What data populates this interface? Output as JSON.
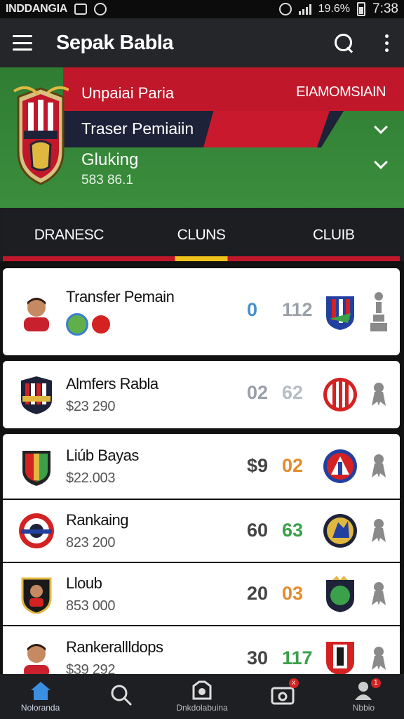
{
  "status_bar": {
    "carrier": "INDDANGIA",
    "battery": "19.6%",
    "time": "7:38"
  },
  "app_bar": {
    "title": "Sepak Babla"
  },
  "hero": {
    "label": "Unpaiai Paria",
    "value": "EIAMOMSIAIN",
    "transfer": "Traser Pemiaiin",
    "gluing": "Gluking",
    "code": "583 86.1"
  },
  "tabs": [
    {
      "label": "DRANESC",
      "active": false
    },
    {
      "label": "CLUNS",
      "active": true
    },
    {
      "label": "CLUIB",
      "active": false
    }
  ],
  "list": [
    {
      "name": "Transfer Pemain",
      "price": "",
      "n1": "0",
      "n2": "112",
      "n1_color": "#4a8fd0",
      "n2_color": "#9aa0aa",
      "avatar": "player"
    },
    {
      "name": "Almfers Rabla",
      "price": "$23 290",
      "n1": "02",
      "n2": "62",
      "n1_color": "#9aa0aa",
      "n2_color": "#b7bcc5",
      "avatar": "crest-red"
    },
    {
      "name": "Liúb Bayas",
      "price": "$22.003",
      "n1": "$9",
      "n2": "02",
      "n1_color": "#444",
      "n2_color": "#e58a2a",
      "avatar": "shield-red-green"
    },
    {
      "name": "Rankaing",
      "price": "823 200",
      "n1": "60",
      "n2": "63",
      "n1_color": "#444",
      "n2_color": "#3aa04a",
      "avatar": "crest-round"
    },
    {
      "name": "Lloub",
      "price": "853 000",
      "n1": "20",
      "n2": "03",
      "n1_color": "#444",
      "n2_color": "#e58a2a",
      "avatar": "crest-dark"
    },
    {
      "name": "Rankerallldops",
      "price": "$39 292",
      "n1": "30",
      "n2": "117",
      "n1_color": "#444",
      "n2_color": "#3aa04a",
      "avatar": "player"
    }
  ],
  "bottom_nav": [
    {
      "label": "Noloranda",
      "icon": "home-icon",
      "active": true
    },
    {
      "label": "",
      "icon": "search-icon",
      "active": false
    },
    {
      "label": "Dnkdolabuina",
      "icon": "camera-icon",
      "active": false
    },
    {
      "label": "",
      "icon": "ticket-icon",
      "badge": "x",
      "active": false
    },
    {
      "label": "Nbbio",
      "icon": "profile-icon",
      "badge": "1",
      "active": false
    }
  ]
}
